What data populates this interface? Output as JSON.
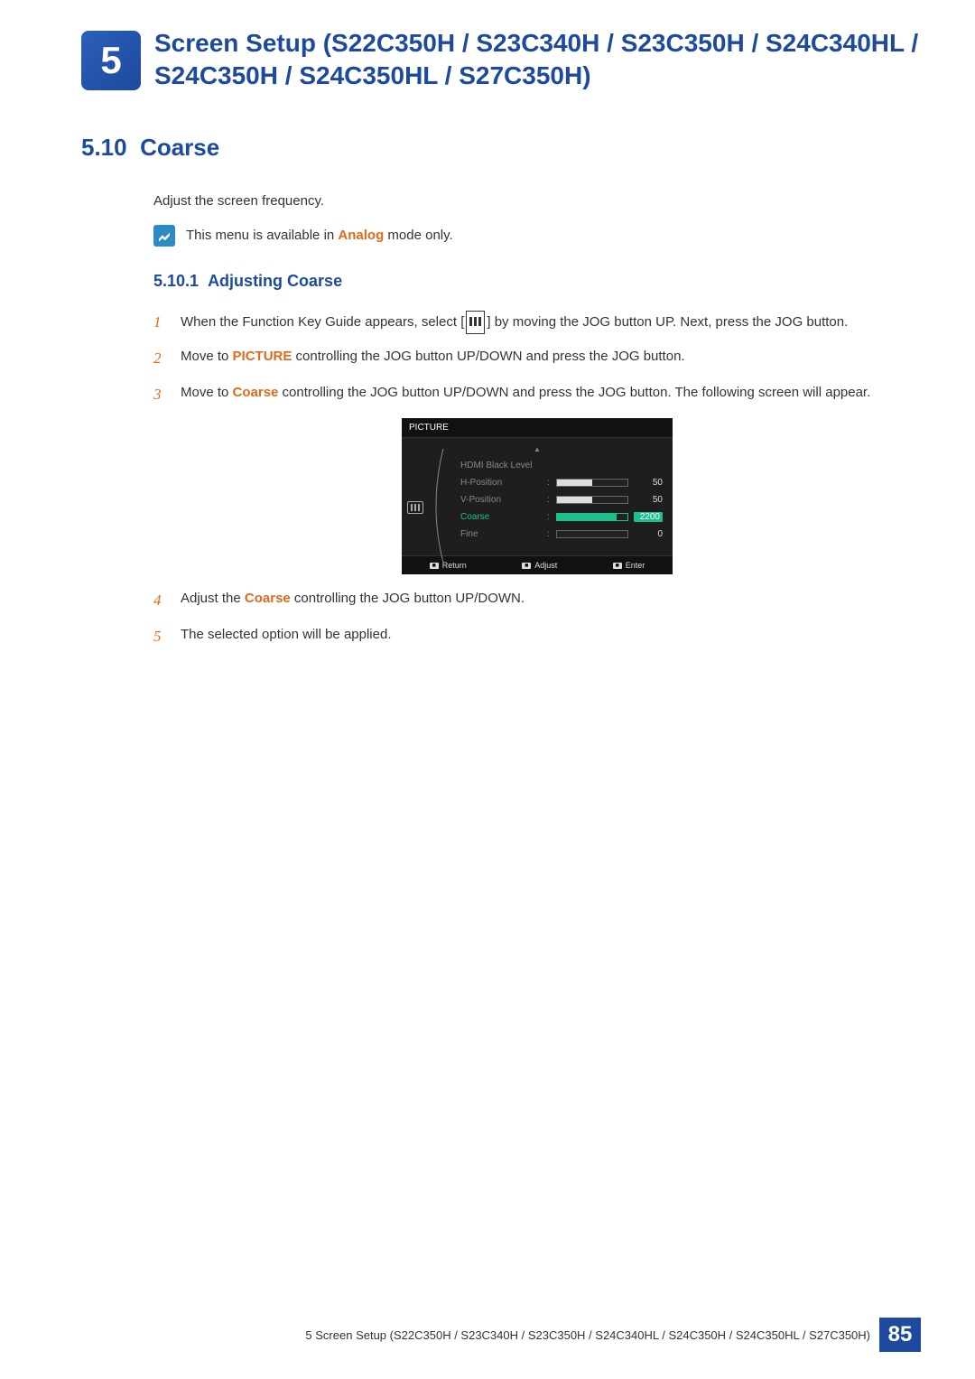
{
  "chapter": {
    "number": "5",
    "title": "Screen Setup (S22C350H / S23C340H / S23C350H / S24C340HL / S24C350H / S24C350HL / S27C350H)"
  },
  "section": {
    "number": "5.10",
    "title": "Coarse",
    "intro": "Adjust the screen frequency.",
    "note_prefix": "This menu is available in ",
    "note_highlight": "Analog",
    "note_suffix": " mode only."
  },
  "subsection": {
    "number": "5.10.1",
    "title": "Adjusting Coarse"
  },
  "steps": {
    "s1a": "When the Function Key Guide appears, select ",
    "s1b": " by moving the JOG button UP. Next, press the JOG button.",
    "s2a": "Move to ",
    "s2_hl": "PICTURE",
    "s2b": " controlling the JOG button UP/DOWN and press the JOG button.",
    "s3a": "Move to ",
    "s3_hl": "Coarse",
    "s3b": " controlling the JOG button UP/DOWN and press the JOG button. The following screen will appear.",
    "s4a": "Adjust the ",
    "s4_hl": "Coarse",
    "s4b": " controlling the JOG button UP/DOWN.",
    "s5": "The selected option will be applied."
  },
  "osd": {
    "header": "PICTURE",
    "items": [
      {
        "label": "HDMI Black Level",
        "value": "",
        "bar": null,
        "active": false
      },
      {
        "label": "H-Position",
        "value": "50",
        "bar": 50,
        "active": false
      },
      {
        "label": "V-Position",
        "value": "50",
        "bar": 50,
        "active": false
      },
      {
        "label": "Coarse",
        "value": "2200",
        "bar": 85,
        "active": true
      },
      {
        "label": "Fine",
        "value": "0",
        "bar": 0,
        "active": false
      }
    ],
    "footer": [
      {
        "label": "Return"
      },
      {
        "label": "Adjust"
      },
      {
        "label": "Enter"
      }
    ]
  },
  "footer": {
    "text": "5 Screen Setup (S22C350H / S23C340H / S23C350H / S24C340HL / S24C350H / S24C350HL / S27C350H)",
    "page": "85"
  }
}
